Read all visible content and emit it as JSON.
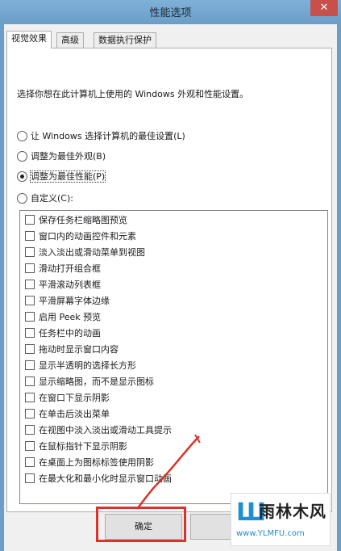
{
  "window": {
    "title": "性能选项",
    "close_glyph": "✕"
  },
  "tabs": [
    {
      "label": "视觉效果",
      "active": true
    },
    {
      "label": "高级",
      "active": false
    },
    {
      "label": "数据执行保护",
      "active": false
    }
  ],
  "description": "选择你想在此计算机上使用的 Windows 外观和性能设置。",
  "radio_options": [
    {
      "label": "让 Windows 选择计算机的最佳设置(L)",
      "checked": false
    },
    {
      "label": "调整为最佳外观(B)",
      "checked": false
    },
    {
      "label": "调整为最佳性能(P)",
      "checked": true
    },
    {
      "label": "自定义(C):",
      "checked": false
    }
  ],
  "effects": [
    {
      "label": "保存任务栏缩略图预览",
      "checked": false
    },
    {
      "label": "窗口内的动画控件和元素",
      "checked": false
    },
    {
      "label": "淡入淡出或滑动菜单到视图",
      "checked": false
    },
    {
      "label": "滑动打开组合框",
      "checked": false
    },
    {
      "label": "平滑滚动列表框",
      "checked": false
    },
    {
      "label": "平滑屏幕字体边缘",
      "checked": false
    },
    {
      "label": "启用 Peek 预览",
      "checked": false
    },
    {
      "label": "任务栏中的动画",
      "checked": false
    },
    {
      "label": "拖动时显示窗口内容",
      "checked": false
    },
    {
      "label": "显示半透明的选择长方形",
      "checked": false
    },
    {
      "label": "显示缩略图，而不是显示图标",
      "checked": false
    },
    {
      "label": "在窗口下显示阴影",
      "checked": false
    },
    {
      "label": "在单击后淡出菜单",
      "checked": false
    },
    {
      "label": "在视图中淡入淡出或滑动工具提示",
      "checked": false
    },
    {
      "label": "在鼠标指针下显示阴影",
      "checked": false
    },
    {
      "label": "在桌面上为图标标签使用阴影",
      "checked": false
    },
    {
      "label": "在最大化和最小化时显示窗口动画",
      "checked": false
    }
  ],
  "buttons": {
    "ok": "确定"
  },
  "watermark": {
    "logo_glyph": "Ш",
    "name": "雨林木风",
    "url": "www.YLMFU.com"
  },
  "colors": {
    "highlight": "#d9332a",
    "titlebar": "#7fb0d8"
  }
}
